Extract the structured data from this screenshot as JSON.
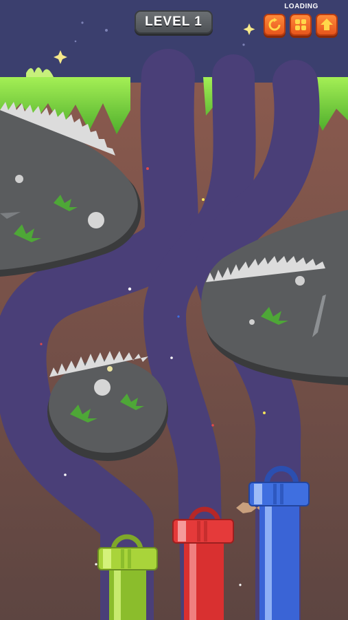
{
  "hud": {
    "level_label": "LEVEL 1",
    "loading_label": "LOADING",
    "buttons": [
      {
        "name": "restart-button",
        "icon": "restart-icon"
      },
      {
        "name": "menu-button",
        "icon": "grid-menu-icon"
      },
      {
        "name": "home-button",
        "icon": "house-arrow-icon"
      }
    ]
  },
  "pipes": [
    {
      "name": "green-pipe",
      "color": "#a9d43a"
    },
    {
      "name": "red-pipe",
      "color": "#e53a3a"
    },
    {
      "name": "blue-pipe",
      "color": "#3f6fe0"
    }
  ],
  "colors": {
    "sky": "#3b3f6e",
    "grass": "#8ee04a",
    "soil": "#6e4a45",
    "channel": "#4a3f78",
    "rock": "#555758",
    "spikes": "#d9d9d9",
    "accent": "#f06a24"
  }
}
